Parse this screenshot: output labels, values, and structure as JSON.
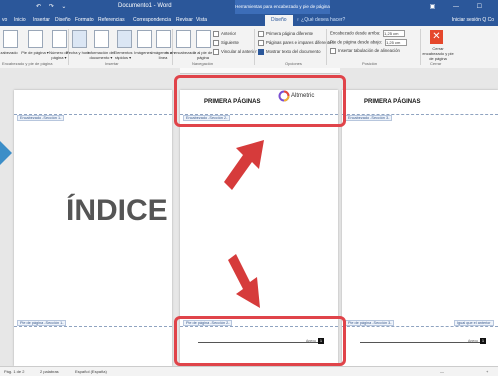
{
  "window": {
    "title": "Documento1 - Word",
    "contextual_tab_group": "Herramientas para encabezado y pie de página",
    "qat": "↶ ↷ ⌄",
    "win_controls": "▣ — ☐"
  },
  "tabs": [
    {
      "label": "vo"
    },
    {
      "label": "Inicio"
    },
    {
      "label": "Insertar"
    },
    {
      "label": "Diseño"
    },
    {
      "label": "Formato"
    },
    {
      "label": "Referencias"
    },
    {
      "label": "Correspondencia"
    },
    {
      "label": "Revisar"
    },
    {
      "label": "Vista"
    },
    {
      "label": "Diseño"
    }
  ],
  "tell_me": "♀ ¿Qué desea hacer?",
  "sign_in": "Iniciar sesión  Q Co",
  "ribbon": {
    "labels": {
      "encabezado": "zabezado",
      "pie": "Pie de página ▾",
      "numero": "Número de página ▾",
      "fecha": "Fecha y hora",
      "info": "Información del documento ▾",
      "elementos": "Elementos rápidos ▾",
      "imagenes": "Imágenes",
      "imagenes_linea": "Imágenes en línea",
      "ir_enc": "Ir al encabezado",
      "ir_pie": "Ir al pie de página"
    },
    "nav": {
      "anterior": "Anterior",
      "siguiente": "Siguiente",
      "vincular": "Vincular al anterior"
    },
    "options": {
      "primera": "Primera página diferente",
      "pares": "Páginas pares e impares diferentes",
      "mostrar": "Mostrar texto del documento"
    },
    "position": {
      "enc_desde": "Encabezado desde arriba:",
      "enc_val": "1,25 cm",
      "pie_desde": "Pie de página desde abajo:",
      "pie_val": "1,25 cm",
      "insertar": "Insertar tabulación de alineación"
    },
    "cerrar": "Cerrar encabezado y pie de página",
    "close_icon": "✕",
    "groups": {
      "enc_pie": "Encabezado y pie de página",
      "insertar": "Insertar",
      "navegacion": "Navegación",
      "opciones": "Opciones",
      "posicion": "Posición",
      "cerrar": "Cerrar"
    }
  },
  "pages": {
    "left": {
      "header_tag": "Encabezado -Sección 1-",
      "title": "ÍNDICE",
      "footer_tag": "Pie de página -Sección 1-"
    },
    "middle": {
      "heading": "PRIMERA PÁGINAS",
      "logo_text": "Altmetric",
      "header_tag": "Encabezado -Sección 2-",
      "footer_tag": "Pie de página -Sección 2-",
      "page_word": "Anexo",
      "page_num": "1"
    },
    "right": {
      "heading": "PRIMERA PÁGINAS",
      "header_tag": "Encabezado -Sección 3-",
      "footer_tag": "Pie de página -Sección 3-",
      "link_tag": "Igual que el anterior",
      "page_word": "Anexo",
      "page_num": "1"
    }
  },
  "status": {
    "page": "Pág. 1 de 2",
    "words": "2 palabras",
    "lang": "Español (España)",
    "zoom_minus": "—",
    "zoom_plus": "+"
  },
  "colors": {
    "accent": "#2b579a",
    "highlight": "#e0444a",
    "arrow": "#d63b3b",
    "blue_arrow": "#3c8ec8",
    "close_button": "#e5472b"
  }
}
